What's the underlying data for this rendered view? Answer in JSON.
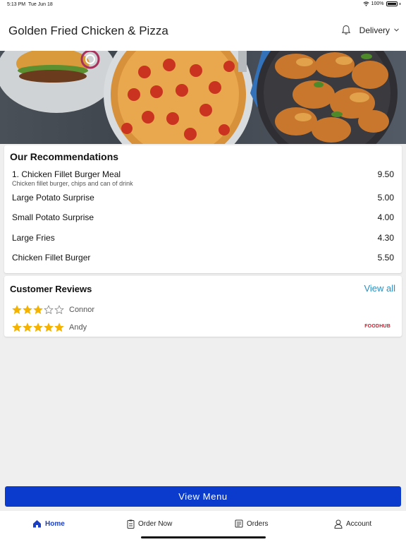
{
  "status_bar": {
    "time": "5:13 PM",
    "date": "Tue Jun 18",
    "battery": "100%"
  },
  "header": {
    "title": "Golden Fried Chicken & Pizza",
    "delivery_label": "Delivery"
  },
  "hero": {
    "image_label": "Burger, pizza, and fried chicken with potato wedges"
  },
  "recommendations": {
    "title": "Our Recommendations",
    "items": [
      {
        "name": "1. Chicken Fillet Burger Meal",
        "description": "Chicken fillet burger, chips and can of drink",
        "price": "9.50"
      },
      {
        "name": "Large Potato Surprise",
        "description": "",
        "price": "5.00"
      },
      {
        "name": "Small Potato Surprise",
        "description": "",
        "price": "4.00"
      },
      {
        "name": "Large Fries",
        "description": "",
        "price": "4.30"
      },
      {
        "name": "Chicken Fillet Burger",
        "description": "",
        "price": "5.50"
      }
    ]
  },
  "reviews": {
    "title": "Customer Reviews",
    "view_all_label": "View all",
    "items": [
      {
        "name": "Connor",
        "rating": 3,
        "max": 5
      },
      {
        "name": "Andy",
        "rating": 5,
        "max": 5
      }
    ],
    "source_logo": "FOODHUB"
  },
  "view_menu_label": "View Menu",
  "tabs": [
    {
      "label": "Home",
      "icon": "home-icon",
      "active": true
    },
    {
      "label": "Order Now",
      "icon": "order-icon",
      "active": false
    },
    {
      "label": "Orders",
      "icon": "receipt-icon",
      "active": false
    },
    {
      "label": "Account",
      "icon": "user-icon",
      "active": false
    }
  ],
  "colors": {
    "accent": "#0b3bcc",
    "link": "#2a8fc0",
    "star": "#f5b301",
    "brand": "#c8202f"
  }
}
